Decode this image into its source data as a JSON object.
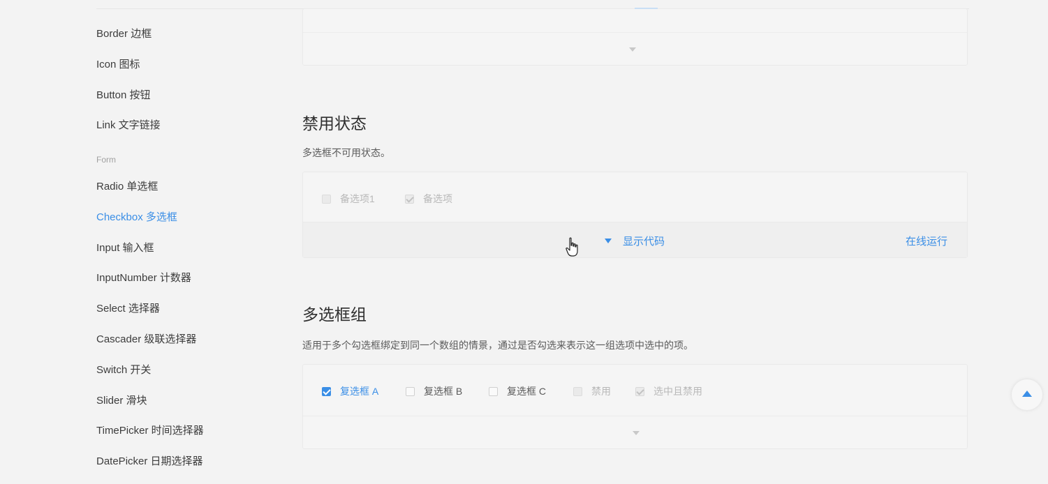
{
  "sidebar": {
    "items": [
      {
        "label": "Border 边框"
      },
      {
        "label": "Icon 图标"
      },
      {
        "label": "Button 按钮"
      },
      {
        "label": "Link 文字链接"
      }
    ],
    "group_label": "Form",
    "form_items": [
      {
        "label": "Radio 单选框"
      },
      {
        "label": "Checkbox 多选框",
        "active": true
      },
      {
        "label": "Input 输入框"
      },
      {
        "label": "InputNumber 计数器"
      },
      {
        "label": "Select 选择器"
      },
      {
        "label": "Cascader 级联选择器"
      },
      {
        "label": "Switch 开关"
      },
      {
        "label": "Slider 滑块"
      },
      {
        "label": "TimePicker 时间选择器"
      },
      {
        "label": "DatePicker 日期选择器"
      }
    ]
  },
  "disabled_section": {
    "title": "禁用状态",
    "description": "多选框不可用状态。",
    "checkboxes": [
      {
        "label": "备选项1",
        "checked": false,
        "disabled": true
      },
      {
        "label": "备选项",
        "checked": true,
        "disabled": true
      }
    ],
    "show_code": "显示代码",
    "online_run": "在线运行"
  },
  "group_section": {
    "title": "多选框组",
    "description": "适用于多个勾选框绑定到同一个数组的情景，通过是否勾选来表示这一组选项中选中的项。",
    "checkboxes": [
      {
        "label": "复选框 A",
        "checked": true,
        "disabled": false
      },
      {
        "label": "复选框 B",
        "checked": false,
        "disabled": false
      },
      {
        "label": "复选框 C",
        "checked": false,
        "disabled": false
      },
      {
        "label": "禁用",
        "checked": false,
        "disabled": true
      },
      {
        "label": "选中且禁用",
        "checked": true,
        "disabled": true
      }
    ]
  },
  "colors": {
    "accent": "#3a8ee6",
    "background": "#f3f3f3"
  },
  "icons": {
    "expand": "caret-down-icon",
    "back_to_top": "arrow-up-icon",
    "cursor": "hand-pointer-icon"
  }
}
